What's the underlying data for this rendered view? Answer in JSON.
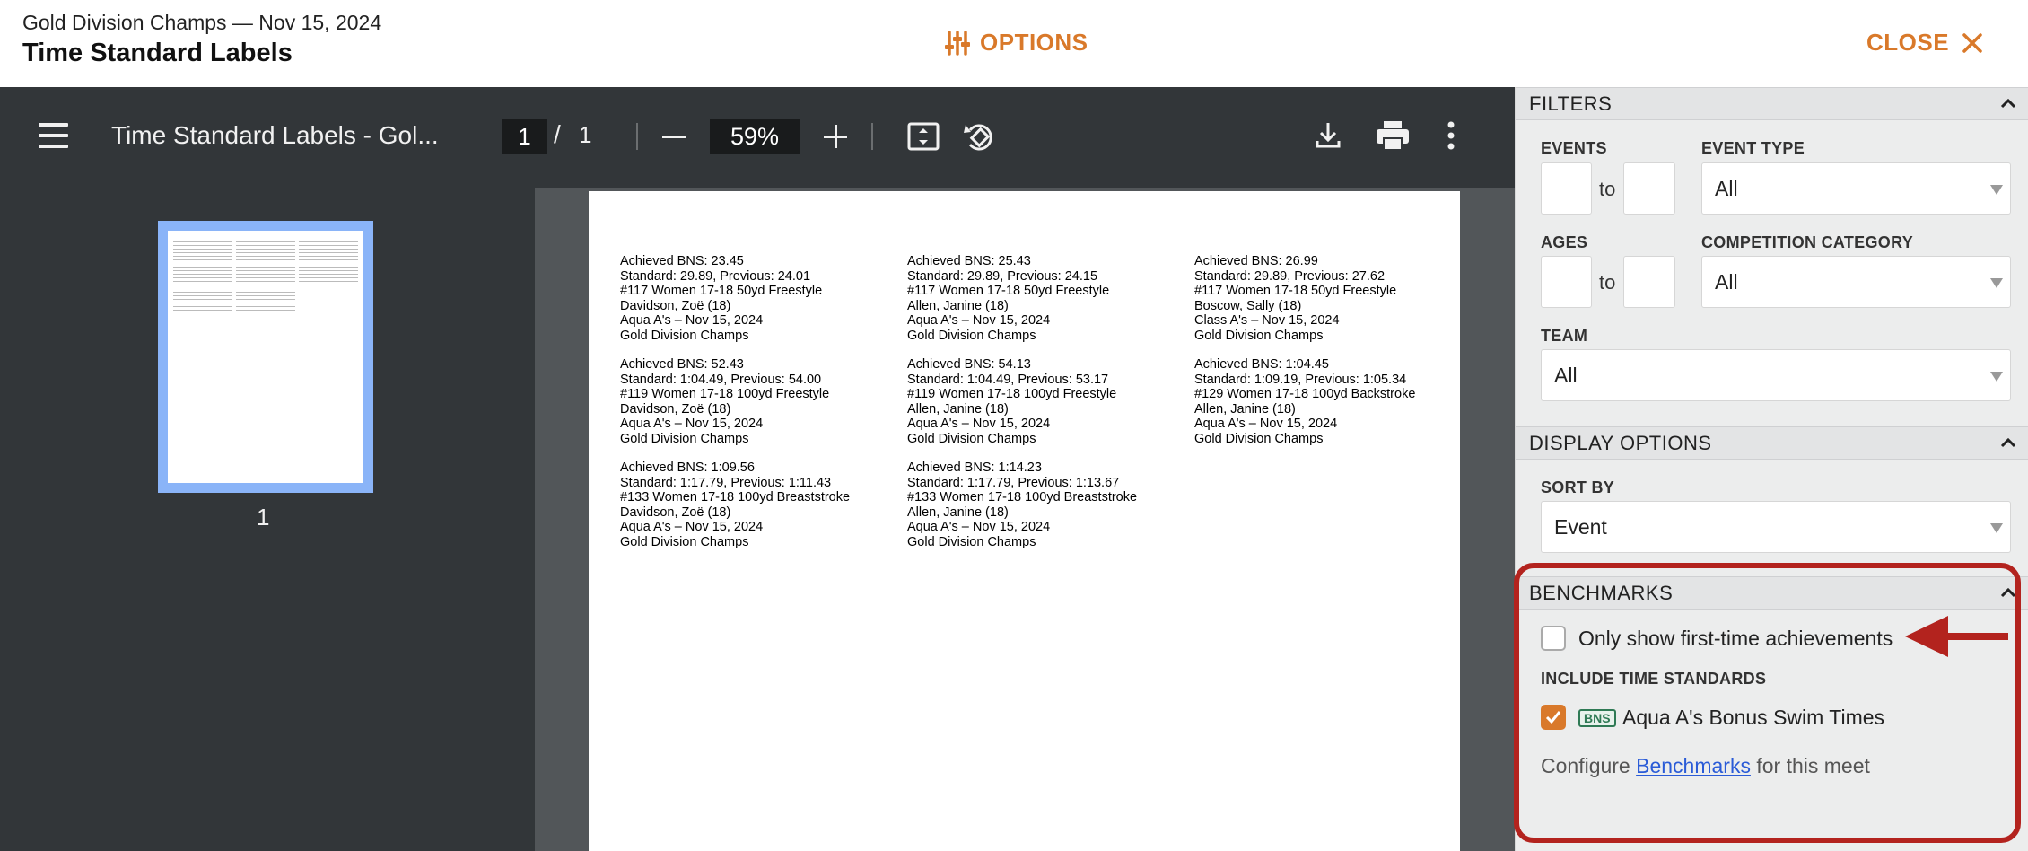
{
  "header": {
    "subtitle": "Gold Division Champs — Nov 15, 2024",
    "title": "Time Standard Labels",
    "options_label": "OPTIONS",
    "close_label": "CLOSE",
    "accent_color": "#d9792a"
  },
  "viewer": {
    "doc_title": "Time Standard Labels - Gol...",
    "page_current": "1",
    "page_separator": "/",
    "page_total": "1",
    "zoom": "59%",
    "thumbnail_label": "1",
    "labels": [
      [
        "Achieved BNS: 23.45",
        "Standard: 29.89, Previous: 24.01",
        "#117 Women 17-18 50yd Freestyle",
        "Davidson, Zoë (18)",
        "Aqua A's – Nov 15, 2024",
        "Gold Division Champs"
      ],
      [
        "Achieved BNS: 25.43",
        "Standard: 29.89, Previous: 24.15",
        "#117 Women 17-18 50yd Freestyle",
        "Allen, Janine (18)",
        "Aqua A's – Nov 15, 2024",
        "Gold Division Champs"
      ],
      [
        "Achieved BNS: 26.99",
        "Standard: 29.89, Previous: 27.62",
        "#117 Women 17-18 50yd Freestyle",
        "Boscow, Sally (18)",
        "Class A's – Nov 15, 2024",
        "Gold Division Champs"
      ],
      [
        "Achieved BNS: 52.43",
        "Standard: 1:04.49, Previous: 54.00",
        "#119 Women 17-18 100yd Freestyle",
        "Davidson, Zoë (18)",
        "Aqua A's – Nov 15, 2024",
        "Gold Division Champs"
      ],
      [
        "Achieved BNS: 54.13",
        "Standard: 1:04.49, Previous: 53.17",
        "#119 Women 17-18 100yd Freestyle",
        "Allen, Janine (18)",
        "Aqua A's – Nov 15, 2024",
        "Gold Division Champs"
      ],
      [
        "Achieved BNS: 1:04.45",
        "Standard: 1:09.19, Previous: 1:05.34",
        "#129 Women 17-18 100yd Backstroke",
        "Allen, Janine (18)",
        "Aqua A's – Nov 15, 2024",
        "Gold Division Champs"
      ],
      [
        "Achieved BNS: 1:09.56",
        "Standard: 1:17.79, Previous: 1:11.43",
        "#133 Women 17-18 100yd Breaststroke",
        "Davidson, Zoë (18)",
        "Aqua A's – Nov 15, 2024",
        "Gold Division Champs"
      ],
      [
        "Achieved BNS: 1:14.23",
        "Standard: 1:17.79, Previous: 1:13.67",
        "#133 Women 17-18 100yd Breaststroke",
        "Allen, Janine (18)",
        "Aqua A's – Nov 15, 2024",
        "Gold Division Champs"
      ]
    ]
  },
  "sidebar": {
    "filters": {
      "heading": "FILTERS",
      "events_label": "EVENTS",
      "events_to": "to",
      "event_type_label": "EVENT TYPE",
      "event_type_value": "All",
      "ages_label": "AGES",
      "ages_to": "to",
      "competition_category_label": "COMPETITION CATEGORY",
      "competition_category_value": "All",
      "team_label": "TEAM",
      "team_value": "All"
    },
    "display_options": {
      "heading": "DISPLAY OPTIONS",
      "sort_by_label": "SORT BY",
      "sort_by_value": "Event"
    },
    "benchmarks": {
      "heading": "BENCHMARKS",
      "first_time_label": "Only show first-time achievements",
      "first_time_checked": false,
      "include_label": "INCLUDE TIME STANDARDS",
      "standard_badge": "BNS",
      "standard_name": "Aqua A's Bonus Swim Times",
      "standard_checked": true,
      "configure_prefix": "Configure",
      "configure_link": "Benchmarks",
      "configure_suffix": "for this meet"
    }
  },
  "annotation_color": "#b3231e"
}
